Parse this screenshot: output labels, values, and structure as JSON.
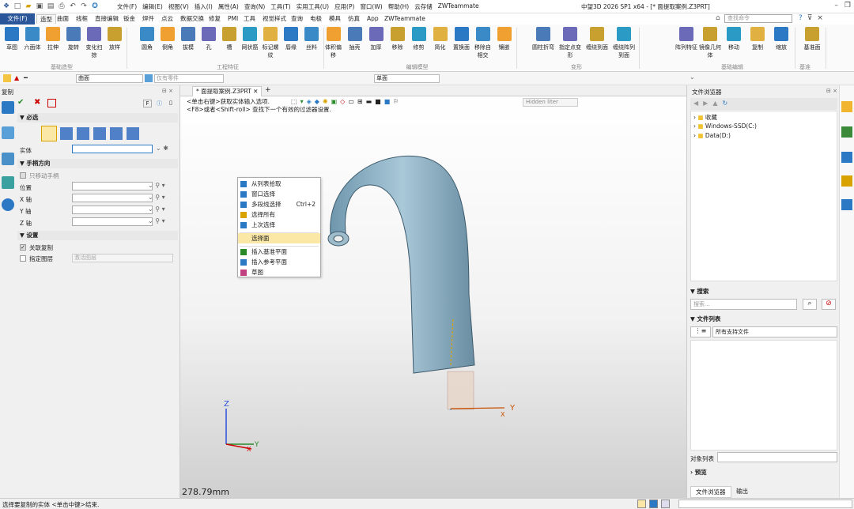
{
  "titlebar": {
    "menu": [
      "文件(F)",
      "编辑(E)",
      "视图(V)",
      "插入(I)",
      "属性(A)",
      "查询(N)",
      "工具(T)",
      "实用工具(U)",
      "应用(P)",
      "窗口(W)",
      "帮助(H)",
      "云存储",
      "ZWTeammate"
    ],
    "title": "中望3D 2026 SP1 x64 - [* 面提取案例.Z3PRT]"
  },
  "tabs": [
    "文件(F)",
    "造型",
    "曲面",
    "线框",
    "直接编辑",
    "钣金",
    "焊件",
    "点云",
    "数据交换",
    "修复",
    "PMI",
    "工具",
    "视觉样式",
    "查询",
    "电极",
    "模具",
    "仿真",
    "App",
    "ZWTeammate"
  ],
  "search": {
    "placeholder": "查找命令"
  },
  "ribbon": {
    "groups": [
      {
        "label": "基础造型",
        "items": [
          "草图",
          "六面体",
          "拉伸",
          "旋转",
          "变化扫掠",
          "放样"
        ]
      },
      {
        "label": "工程特征",
        "items": [
          "圆角",
          "倒角",
          "拔模",
          "孔",
          "槽",
          "网状筋",
          "标记螺纹",
          "唇缘",
          "丝料"
        ]
      },
      {
        "label": "编辑模型",
        "items": [
          "体积偏移",
          "抽壳",
          "加厚",
          "移除",
          "修剪",
          "简化",
          "置换面",
          "移除自相交",
          "镶嵌"
        ]
      },
      {
        "label": "变形",
        "items": [
          "圆柱折弯",
          "指定点变形",
          "缠绕到面",
          "缠绕阵列到面"
        ]
      },
      {
        "label": "基础编辑",
        "items": [
          "阵列特征",
          "镜像几何体",
          "移动",
          "复制",
          "缩放"
        ]
      },
      {
        "label": "基准",
        "items": [
          "基准面"
        ]
      }
    ]
  },
  "toolbar2": {
    "filter": "曲面",
    "part": "仅有零件",
    "pick": "单面"
  },
  "left_panel": {
    "title": "复制",
    "section_required": "必选",
    "field_entity": "实体",
    "section_handle": "手柄方向",
    "check_move_handle": "只移动手柄",
    "field_position": "位置",
    "field_x": "X 轴",
    "field_y": "Y 轴",
    "field_z": "Z 轴",
    "section_settings": "设置",
    "check_assoc": "关联复制",
    "check_layer": "指定图层",
    "layer_value": "激活图层"
  },
  "doc_tab": "* 面提取案例.Z3PRT",
  "viewport": {
    "hint1": "<单击右键>获取实体输入选项.",
    "hint2": "<F8>或者<Shift-roll> 查找下一个有效的过滤器设置.",
    "render_mode": "Hidden liter",
    "scale": "278.79mm"
  },
  "context_menu": [
    {
      "label": "从列表拾取",
      "shortcut": ""
    },
    {
      "label": "窗口选择",
      "shortcut": ""
    },
    {
      "label": "多段线选择",
      "shortcut": "Ctrl+2"
    },
    {
      "label": "选择所有",
      "shortcut": ""
    },
    {
      "label": "上次选择",
      "shortcut": ""
    },
    {
      "label": "选择面",
      "shortcut": ""
    },
    {
      "label": "插入基准平面",
      "shortcut": ""
    },
    {
      "label": "插入参考平面",
      "shortcut": ""
    },
    {
      "label": "草图",
      "shortcut": ""
    }
  ],
  "right_panel": {
    "title": "文件浏览器",
    "tree": [
      "收藏",
      "Windows-SSD(C:)",
      "Data(D:)"
    ],
    "search_title": "搜索",
    "search_placeholder": "搜索...",
    "filelist_title": "文件列表",
    "filter_all": "所有支持文件",
    "objlist": "对象列表",
    "preview": "预览",
    "bottom_tabs": [
      "文件浏览器",
      "输出"
    ]
  },
  "status": {
    "text": "选择要复制的实体 <单击中键>结束."
  },
  "colors": {
    "accent": "#2b579a",
    "highlight": "#fbe8a6",
    "faucet": "#8fb4c8"
  }
}
